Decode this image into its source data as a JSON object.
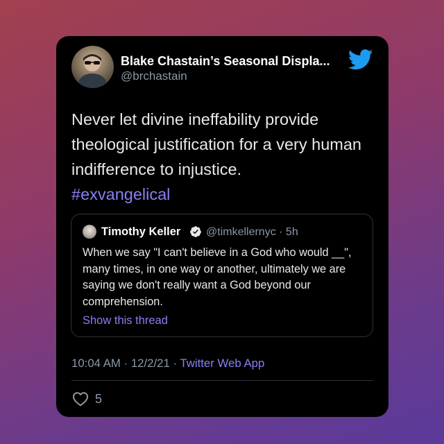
{
  "tweet": {
    "display_name": "Blake Chastain’s Seasonal Displa...",
    "handle": "@brchastain",
    "text": "Never let divine ineffability provide theological justification for a very human indifference to injustice.",
    "hashtag": "#exvangelical",
    "timestamp": "10:04 AM · 12/2/21 · ",
    "source_app": "Twitter Web App",
    "like_count": "5"
  },
  "quoted": {
    "display_name": "Timothy Keller",
    "handle_time": "@timkellernyc · 5h",
    "text": "When we say \"I can't believe in a God who would __\", many times, in one way or another, ultimately we are saying we don't really want a God beyond our comprehension.",
    "show_thread": "Show this thread"
  },
  "icons": {
    "brand": "twitter-bird-icon",
    "verified": "verified-badge-icon",
    "like": "heart-outline-icon"
  },
  "colors": {
    "accent": "#8a7ff4",
    "twitter_blue": "#1d9bf0",
    "card_bg": "#000000",
    "muted_text": "#8b98a5"
  }
}
